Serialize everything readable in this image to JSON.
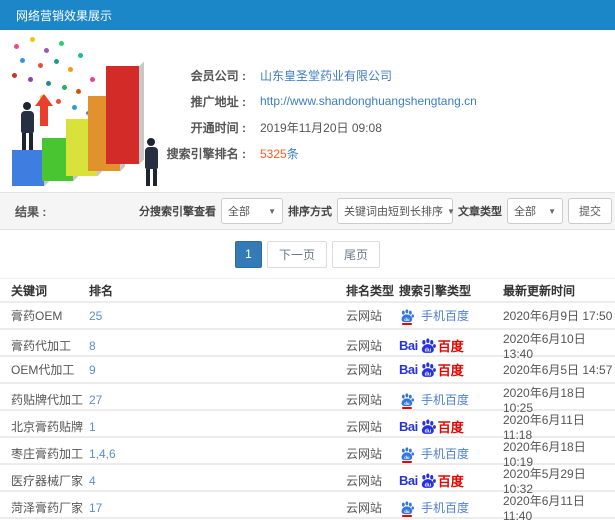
{
  "header": {
    "title": "网络营销效果展示",
    "bg_color": "#1c87c8"
  },
  "info": {
    "rows": [
      {
        "label": "会员公司 :",
        "value": "山东皇圣堂药业有限公司"
      },
      {
        "label": "推广地址 :",
        "value": "http://www.shandonghuangshengtang.cn"
      },
      {
        "label": "开通时间 :",
        "value": "2019年11月20日 09:08"
      },
      {
        "label": "搜索引擎排名 :",
        "value": "5325",
        "suffix": "条"
      }
    ]
  },
  "filter": {
    "result_label": "结果 :",
    "engine_view_label": "分搜索引擎查看",
    "engine_view_value": "全部",
    "sort_label": "排序方式",
    "sort_value": "关键词由短到长排序",
    "article_type_label": "文章类型",
    "article_type_value": "全部",
    "submit_label": "提交"
  },
  "pagination": {
    "current": "1",
    "next": "下一页",
    "last": "尾页"
  },
  "icons": {
    "baidu_pc": {
      "bai": "Bai",
      "du": "du",
      "baidu": "百度"
    },
    "baidu_mobile_du": "du"
  },
  "colors": {
    "header_blue": "#1c87c8",
    "link_blue": "#3d7dc1",
    "count_orange": "#ff5b22",
    "rank_blue": "#5b8fc9",
    "baidu_red": "#e10601",
    "baidu_blue": "#2633dc",
    "mobile_blue": "#4d7fd3",
    "active_page": "#337ab7"
  },
  "table": {
    "headers": [
      "关键词",
      "排名",
      "排名类型",
      "搜索引擎类型",
      "最新更新时间"
    ],
    "rows": [
      {
        "keyword": "膏药OEM",
        "rank": "25",
        "rank_type": "云网站",
        "engine": "mobile",
        "engine_label": "手机百度",
        "time": "2020年6月9日 17:50"
      },
      {
        "keyword": "膏药代加工",
        "rank": "8",
        "rank_type": "云网站",
        "engine": "pc",
        "engine_label": "Baidu百度",
        "time": "2020年6月10日 13:40"
      },
      {
        "keyword": "OEM代加工",
        "rank": "9",
        "rank_type": "云网站",
        "engine": "pc",
        "engine_label": "Baidu百度",
        "time": "2020年6月5日 14:57"
      },
      {
        "keyword": "药贴牌代加工",
        "rank": "27",
        "rank_type": "云网站",
        "engine": "mobile",
        "engine_label": "手机百度",
        "time": "2020年6月18日 10:25"
      },
      {
        "keyword": "北京膏药贴牌",
        "rank": "1",
        "rank_type": "云网站",
        "engine": "pc",
        "engine_label": "Baidu百度",
        "time": "2020年6月11日 11:18"
      },
      {
        "keyword": "枣庄膏药加工",
        "rank": "1,4,6",
        "rank_type": "云网站",
        "engine": "mobile",
        "engine_label": "手机百度",
        "time": "2020年6月18日 10:19"
      },
      {
        "keyword": "医疗器械厂家",
        "rank": "4",
        "rank_type": "云网站",
        "engine": "pc",
        "engine_label": "Baidu百度",
        "time": "2020年5月29日 10:32"
      },
      {
        "keyword": "菏泽膏药厂家",
        "rank": "17",
        "rank_type": "云网站",
        "engine": "mobile",
        "engine_label": "手机百度",
        "time": "2020年6月11日 11:40"
      }
    ]
  }
}
